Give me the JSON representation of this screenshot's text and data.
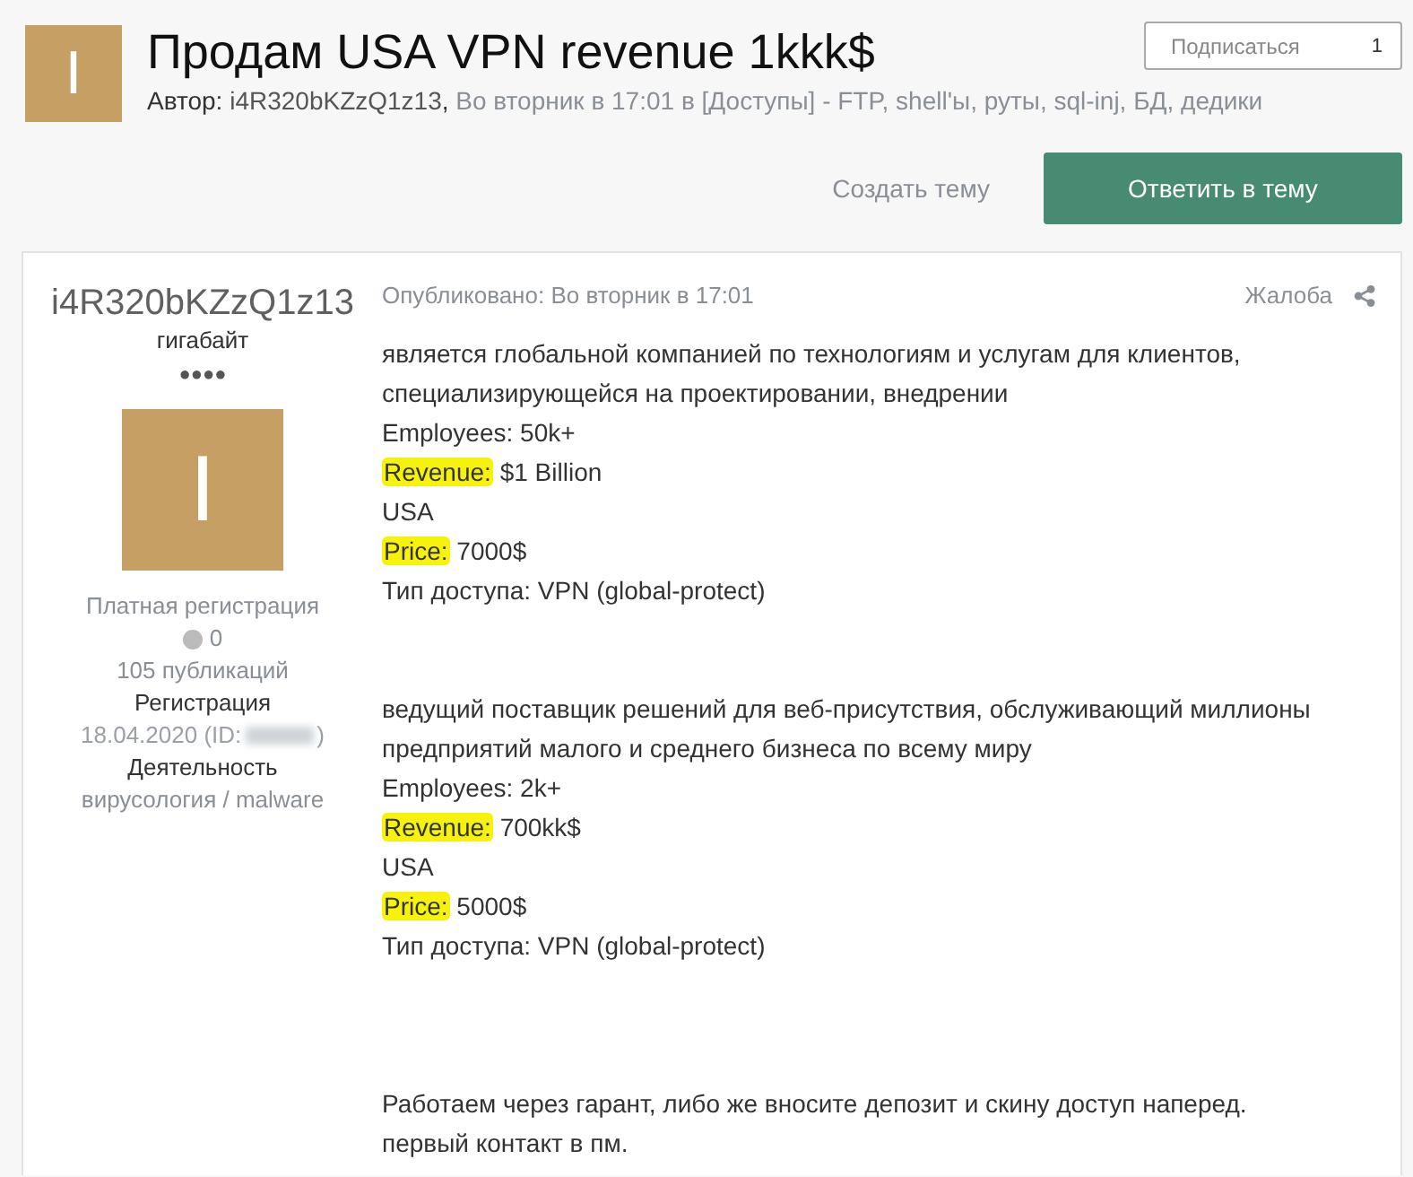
{
  "topic": {
    "avatar_letter": "I",
    "title": "Продам USA VPN revenue 1kkk$",
    "author_label": "Автор:",
    "author": "i4R320bKZzQ1z13",
    "author_sep": ",",
    "meta": "Во вторник в 17:01 в [Доступы] - FTP, shell'ы, руты, sql-inj, БД, дедики",
    "subscribe": {
      "label": "Подписаться",
      "count": "1"
    }
  },
  "actions": {
    "create": "Создать тему",
    "reply": "Ответить в тему"
  },
  "post": {
    "author": {
      "name": "i4R320bKZzQ1z13",
      "rank": "гигабайт",
      "rank_pips": "●●●●",
      "avatar_letter": "I",
      "group": "Платная регистрация",
      "reputation": "0",
      "posts": "105 публикаций",
      "reg_label": "Регистрация",
      "reg_date": "18.04.2020 (ID:",
      "reg_close": ")",
      "activity_label": "Деятельность",
      "activity": "вирусология / malware"
    },
    "published": "Опубликовано: Во вторник в 17:01",
    "report": "Жалоба",
    "lines": [
      {
        "kind": "text",
        "text": "является глобальной компанией по технологиям и услугам для клиентов,"
      },
      {
        "kind": "text",
        "text": "специализирующейся на проектировании, внедрении"
      },
      {
        "kind": "text",
        "text": "Employees: 50k+"
      },
      {
        "kind": "marked",
        "mark": "Revenue:",
        "text": "$1 Billion"
      },
      {
        "kind": "text",
        "text": "USA"
      },
      {
        "kind": "marked",
        "mark": "Price:",
        "text": "7000$"
      },
      {
        "kind": "text",
        "text": "Тип доступа: VPN (global-protect)"
      },
      {
        "kind": "blank"
      },
      {
        "kind": "blank"
      },
      {
        "kind": "text",
        "text": "ведущий поставщик решений для веб-присутствия, обслуживающий миллионы"
      },
      {
        "kind": "text",
        "text": "предприятий малого и среднего бизнеса по всему миру"
      },
      {
        "kind": "text",
        "text": "Employees: 2k+"
      },
      {
        "kind": "marked",
        "mark": "Revenue:",
        "text": "700kk$"
      },
      {
        "kind": "text",
        "text": "USA"
      },
      {
        "kind": "marked",
        "mark": "Price:",
        "text": "5000$"
      },
      {
        "kind": "text",
        "text": "Тип доступа: VPN (global-protect)"
      },
      {
        "kind": "blank"
      },
      {
        "kind": "blank"
      },
      {
        "kind": "blank"
      },
      {
        "kind": "text",
        "text": "Работаем через гарант, либо же вносите депозит и скину доступ наперед."
      },
      {
        "kind": "text",
        "text": "первый контакт в пм."
      }
    ]
  }
}
